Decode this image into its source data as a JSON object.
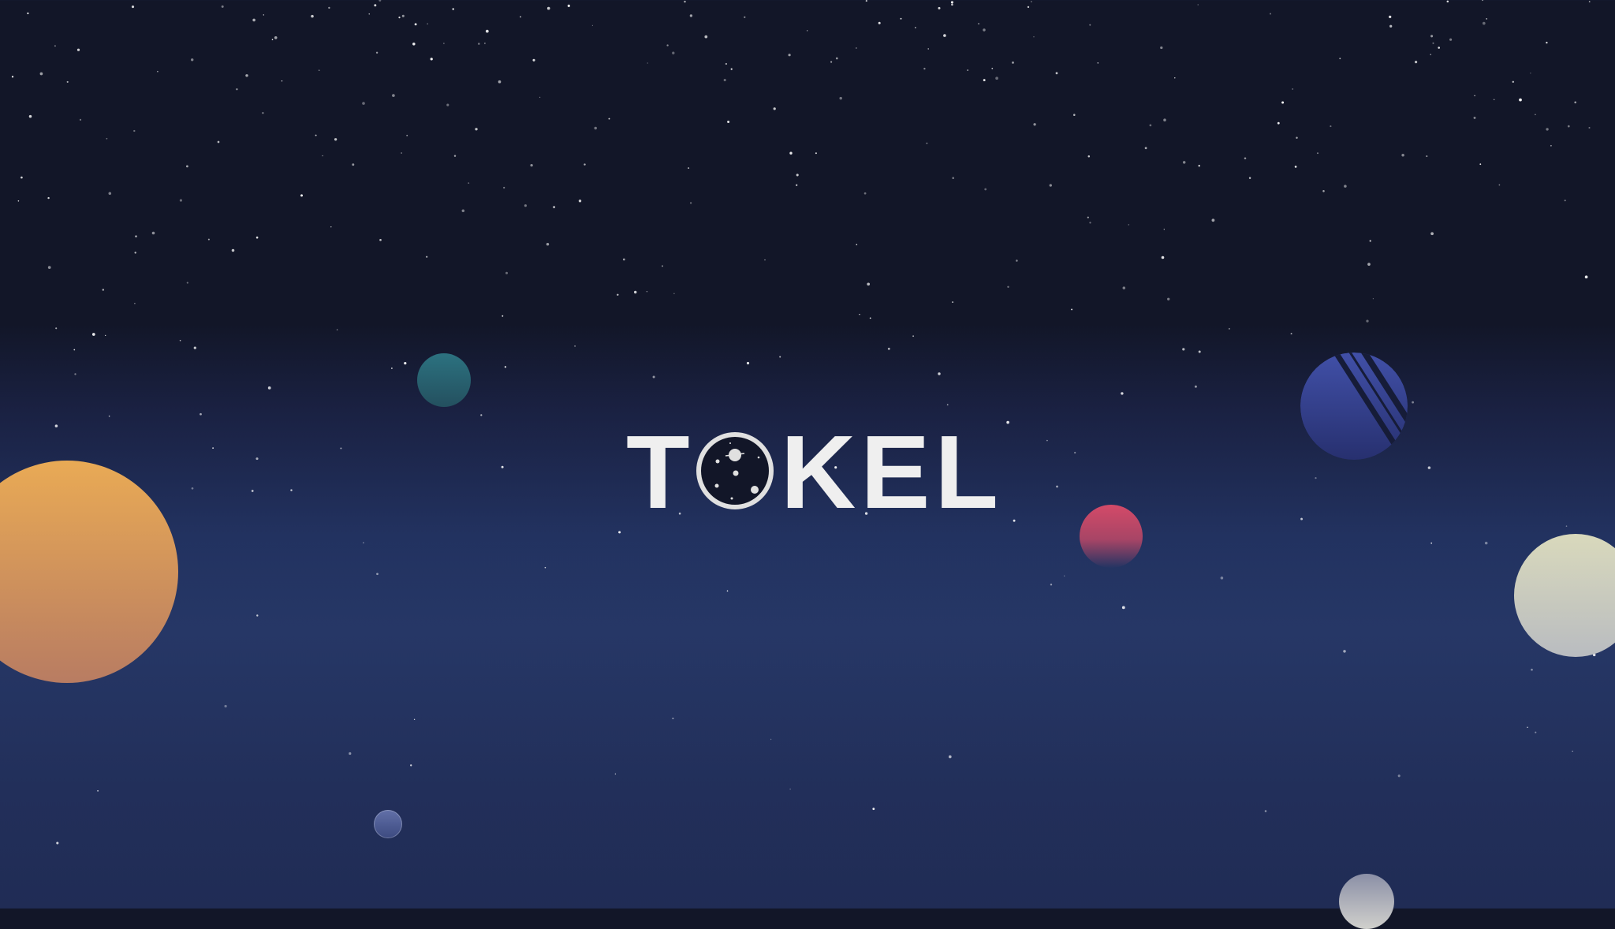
{
  "logo": {
    "text_before": "T",
    "text_after": "KEL",
    "full": "TOKEL"
  },
  "colors": {
    "sky_top": "#121628",
    "sky_bottom": "#263766",
    "logo": "#efefef",
    "planet_orange": "#e8a955",
    "planet_teal": "#2c6b7a",
    "planet_blue": "#3a47a0",
    "planet_pink": "#d04a68",
    "planet_cream": "#d8d8bd"
  }
}
